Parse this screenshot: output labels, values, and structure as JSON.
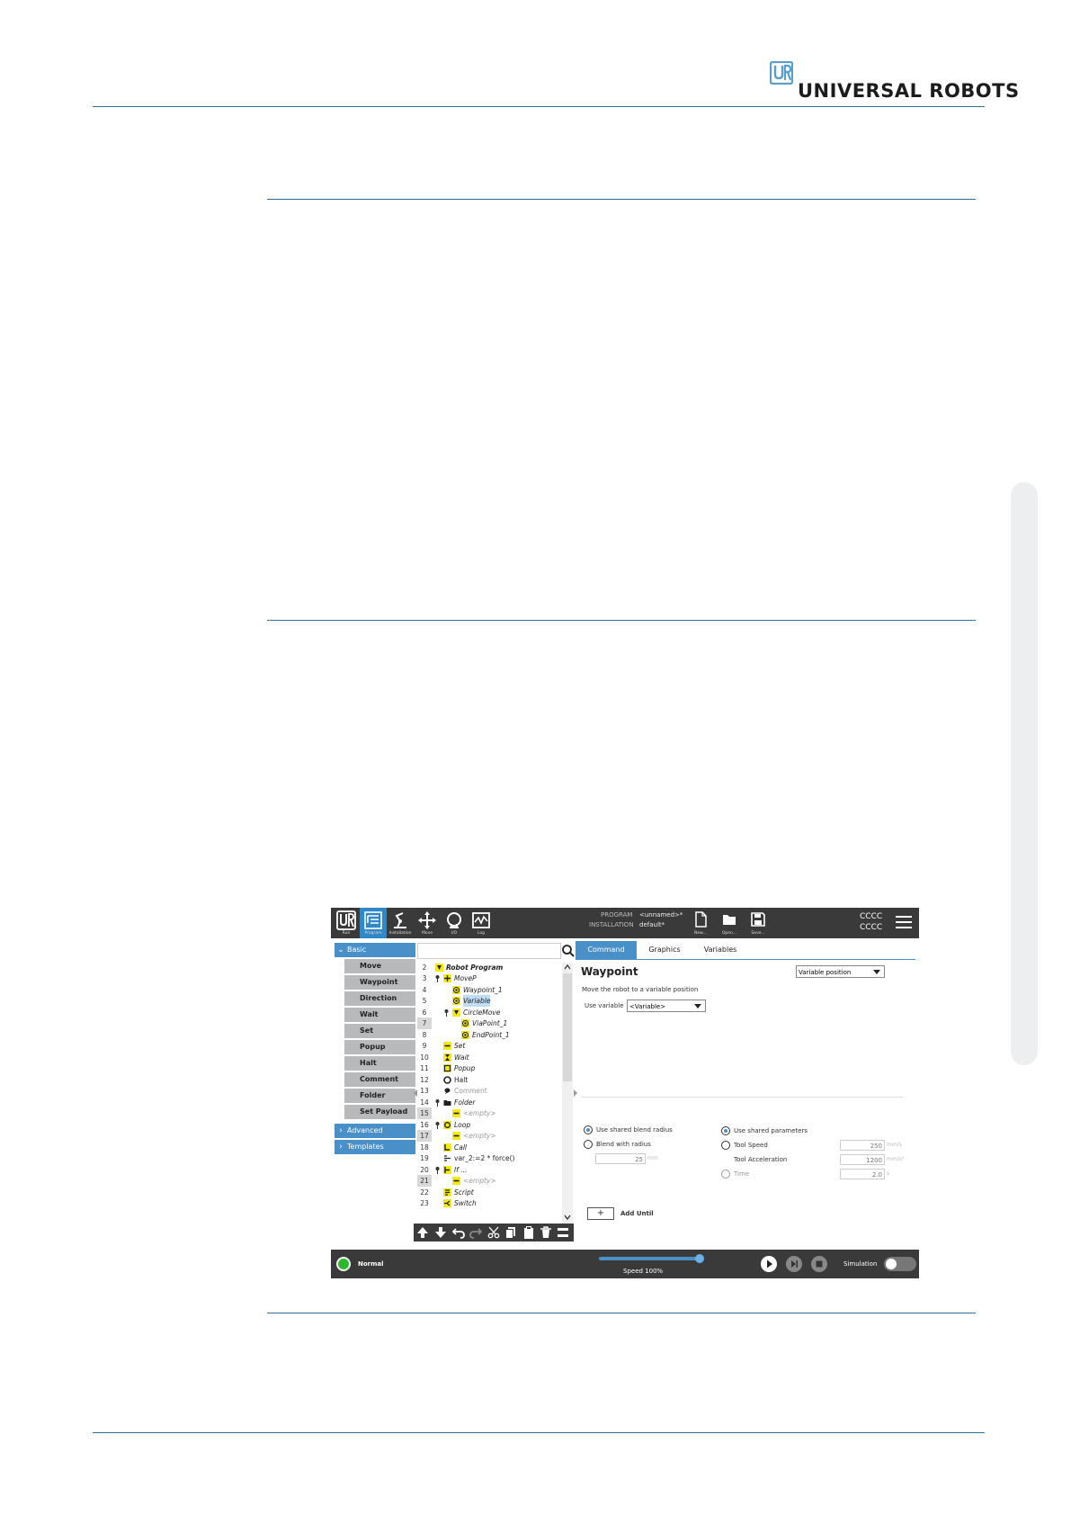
{
  "header": {
    "logo_text": "UNIVERSAL ROBOTS",
    "brand_color": "#2f6f94"
  },
  "screenshot": {
    "topbar": {
      "nav": [
        {
          "label": "Run",
          "icon": "ur-logo-icon"
        },
        {
          "label": "Program",
          "icon": "program-icon"
        },
        {
          "label": "Installation",
          "icon": "installation-icon"
        },
        {
          "label": "Move",
          "icon": "move-icon"
        },
        {
          "label": "I/O",
          "icon": "io-icon"
        },
        {
          "label": "Log",
          "icon": "log-icon"
        }
      ],
      "program_label": "PROGRAM",
      "program_value": "<unnamed>*",
      "installation_label": "INSTALLATION",
      "installation_value": "default*",
      "file_buttons": [
        {
          "label": "New...",
          "icon": "new-file-icon"
        },
        {
          "label": "Open...",
          "icon": "open-folder-icon"
        },
        {
          "label": "Save...",
          "icon": "save-icon"
        }
      ],
      "right_text_1": "CCCC",
      "right_text_2": "CCCC"
    },
    "left_panel": {
      "basic_label": "Basic",
      "basic_items": [
        "Move",
        "Waypoint",
        "Direction",
        "Wait",
        "Set",
        "Popup",
        "Halt",
        "Comment",
        "Folder",
        "Set Payload"
      ],
      "advanced_label": "Advanced",
      "templates_label": "Templates"
    },
    "tree": {
      "rows": [
        {
          "num": "2",
          "label": "Robot Program"
        },
        {
          "num": "3",
          "label": "MoveP"
        },
        {
          "num": "4",
          "label": "Waypoint_1"
        },
        {
          "num": "5",
          "label": "Variable"
        },
        {
          "num": "6",
          "label": "CircleMove"
        },
        {
          "num": "7",
          "label": "ViaPoint_1"
        },
        {
          "num": "8",
          "label": "EndPoint_1"
        },
        {
          "num": "9",
          "label": "Set"
        },
        {
          "num": "10",
          "label": "Wait"
        },
        {
          "num": "11",
          "label": "Popup"
        },
        {
          "num": "12",
          "label": "Halt"
        },
        {
          "num": "13",
          "label": "Comment"
        },
        {
          "num": "14",
          "label": "Folder"
        },
        {
          "num": "15",
          "label": "<empty>"
        },
        {
          "num": "16",
          "label": "Loop"
        },
        {
          "num": "17",
          "label": "<empty>"
        },
        {
          "num": "18",
          "label": "Call"
        },
        {
          "num": "19",
          "label": "var_2:=2 * force()"
        },
        {
          "num": "20",
          "label": "If ..."
        },
        {
          "num": "21",
          "label": "<empty>"
        },
        {
          "num": "22",
          "label": "Script"
        },
        {
          "num": "23",
          "label": "Switch"
        }
      ]
    },
    "tabs": [
      "Command",
      "Graphics",
      "Variables"
    ],
    "command": {
      "title": "Waypoint",
      "type_select": "Variable position",
      "description": "Move the robot to a variable position",
      "use_variable_label": "Use variable",
      "use_variable_value": "<Variable>",
      "shared_blend_label": "Use shared blend radius",
      "blend_with_radius_label": "Blend with radius",
      "blend_value": "25",
      "blend_unit": "mm",
      "shared_params_label": "Use shared parameters",
      "tool_speed_label": "Tool Speed",
      "tool_speed_value": "250",
      "tool_speed_unit": "mm/s",
      "tool_accel_label": "Tool Acceleration",
      "tool_accel_value": "1200",
      "tool_accel_unit": "mm/s²",
      "time_label": "Time",
      "time_value": "2.0",
      "time_unit": "s",
      "add_until_label": "Add Until",
      "add_symbol": "+"
    },
    "bottombar": {
      "status_label": "Normal",
      "speed_label": "Speed 100%",
      "simulation_label": "Simulation"
    }
  }
}
